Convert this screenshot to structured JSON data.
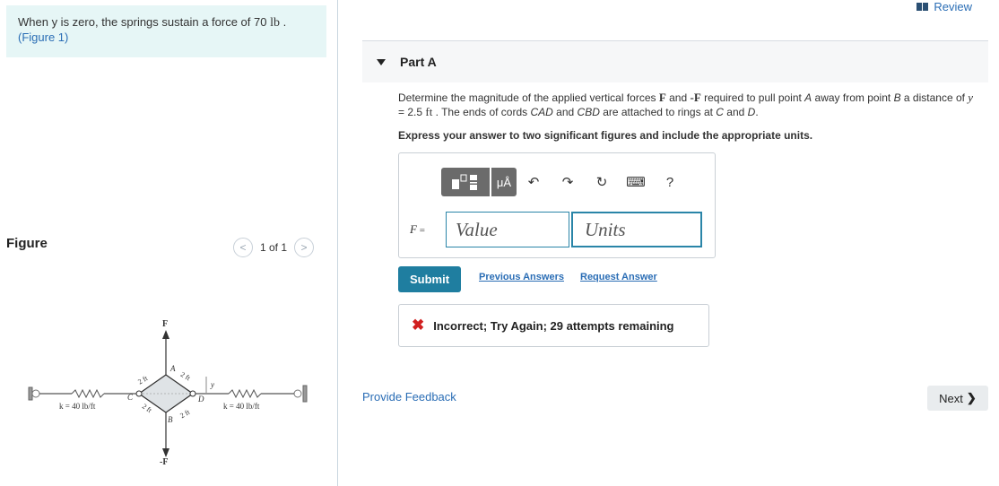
{
  "intro": {
    "text_before": "When y is zero, the springs sustain a force of 70 ",
    "unit": "lb",
    "text_after": " .",
    "figure_link": "(Figure 1)"
  },
  "figure_panel": {
    "label": "Figure",
    "pager_text": "1 of 1",
    "prev_glyph": "<",
    "next_glyph": ">",
    "diagram": {
      "top_force": "F",
      "bottom_force": "-F",
      "left_spring": "k = 40 lb/ft",
      "right_spring": "k = 40 lb/ft",
      "point_a": "A",
      "point_b": "B",
      "point_c": "C",
      "point_d": "D",
      "dim_2ft": "2 ft",
      "dim_y": "y"
    }
  },
  "header": {
    "review_label": "Review"
  },
  "part": {
    "title": "Part A",
    "question": {
      "t1": "Determine the magnitude of the applied vertical forces ",
      "f1": "F",
      "t2": " and ",
      "f2": "-F",
      "t3": " required to pull point ",
      "a": "A",
      "t4": " away from point ",
      "b": "B",
      "t5": " a distance of ",
      "y": "y",
      "t6": " = 2.5 ",
      "ft": "ft",
      "t7": " . The ends of cords ",
      "cad": "CAD",
      "t8": " and ",
      "cbd": "CBD",
      "t9": " are attached to rings at ",
      "c": "C",
      "t10": " and ",
      "d": "D",
      "t11": "."
    },
    "instruction": "Express your answer to two significant figures and include the appropriate units.",
    "answer": {
      "var_label": "F",
      "equals": " =",
      "value_placeholder": "Value",
      "units_placeholder": "Units",
      "toolbar": {
        "units_glyph": "μÅ",
        "undo_glyph": "↶",
        "redo_glyph": "↷",
        "reset_glyph": "↻",
        "keyboard_glyph": "⌨",
        "help_glyph": "?"
      }
    },
    "submit_label": "Submit",
    "previous_answers_label": "Previous Answers",
    "request_answer_label": "Request Answer",
    "feedback": {
      "icon": "✖",
      "text": "Incorrect; Try Again; 29 attempts remaining"
    }
  },
  "footer": {
    "provide_feedback": "Provide Feedback",
    "next_label": "Next",
    "next_glyph": "❯"
  }
}
